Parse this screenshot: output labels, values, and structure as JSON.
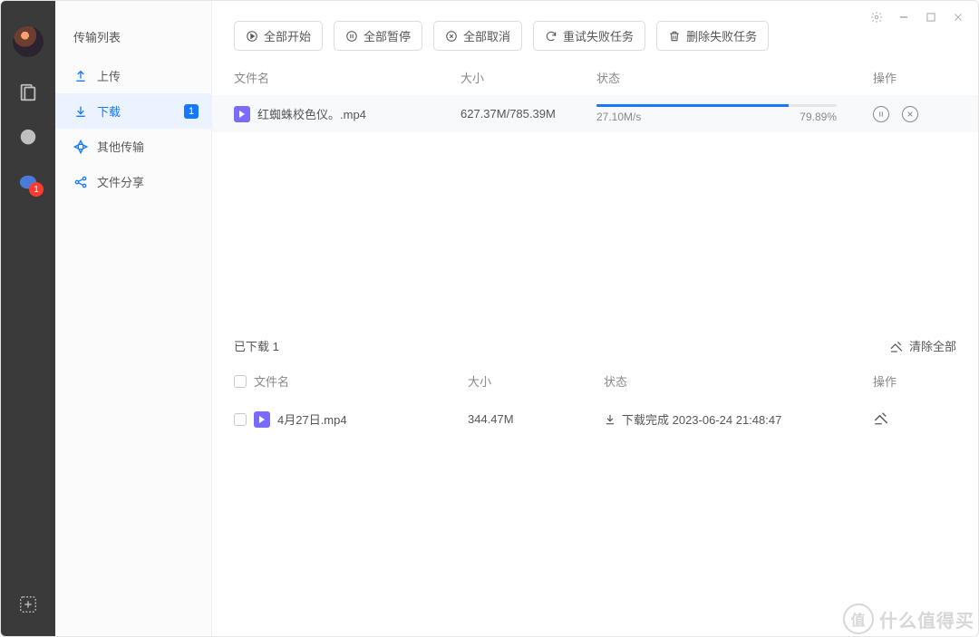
{
  "rail": {
    "chat_badge": "1"
  },
  "sidebar": {
    "title": "传输列表",
    "items": [
      {
        "label": "上传"
      },
      {
        "label": "下载",
        "count": "1"
      },
      {
        "label": "其他传输"
      },
      {
        "label": "文件分享"
      }
    ]
  },
  "toolbar": {
    "start_all": "全部开始",
    "pause_all": "全部暂停",
    "cancel_all": "全部取消",
    "retry_failed": "重试失败任务",
    "delete_failed": "删除失败任务"
  },
  "columns": {
    "name": "文件名",
    "size": "大小",
    "status": "状态",
    "action": "操作"
  },
  "active": {
    "name": "红蜘蛛校色仪。.mp4",
    "size": "627.37M/785.39M",
    "speed": "27.10M/s",
    "percent": "79.89%",
    "progress_pct": 79.89
  },
  "downloaded": {
    "header": "已下载 1",
    "clear_all": "清除全部",
    "row": {
      "name": "4月27日.mp4",
      "size": "344.47M",
      "status": "下载完成 2023-06-24 21:48:47"
    }
  },
  "watermark": {
    "circle": "值",
    "text": "什么值得买"
  }
}
